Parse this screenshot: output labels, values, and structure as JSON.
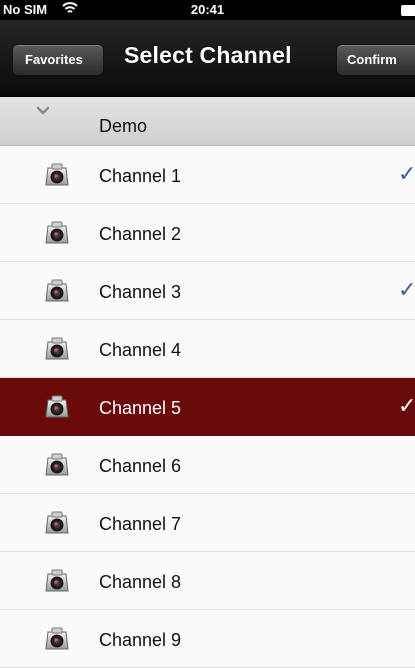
{
  "status_bar": {
    "carrier": "No SIM",
    "time": "20:41",
    "wifi_icon": "wifi-icon",
    "battery_icon": "battery-icon"
  },
  "nav": {
    "back_label": "Favorites",
    "title": "Select Channel",
    "confirm_label": "Confirm"
  },
  "group": {
    "name": "Demo",
    "icon": "chevron-down-icon"
  },
  "channels": [
    {
      "label": "Channel 1",
      "checked": true,
      "highlighted": false
    },
    {
      "label": "Channel 2",
      "checked": false,
      "highlighted": false
    },
    {
      "label": "Channel 3",
      "checked": true,
      "highlighted": false
    },
    {
      "label": "Channel 4",
      "checked": false,
      "highlighted": false
    },
    {
      "label": "Channel 5",
      "checked": true,
      "highlighted": true
    },
    {
      "label": "Channel 6",
      "checked": false,
      "highlighted": false
    },
    {
      "label": "Channel 7",
      "checked": false,
      "highlighted": false
    },
    {
      "label": "Channel 8",
      "checked": false,
      "highlighted": false
    },
    {
      "label": "Channel 9",
      "checked": false,
      "highlighted": false
    }
  ],
  "check_glyph": "✓",
  "colors": {
    "highlight": "#6a0a0a",
    "check": "#3a5fa0",
    "nav_bar": "#1a1a1a"
  }
}
